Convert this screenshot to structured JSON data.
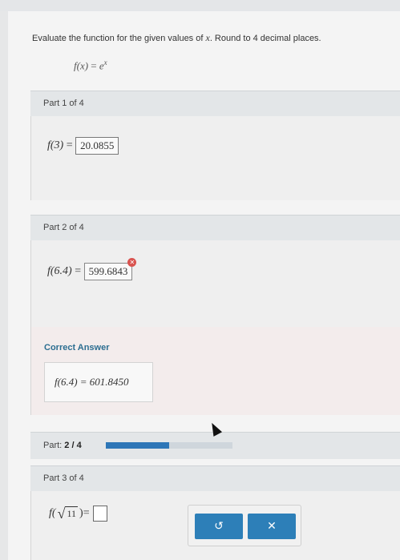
{
  "question": {
    "prefix": "Evaluate the function for the given values of ",
    "var": "x",
    "suffix": ". Round to 4 decimal places."
  },
  "function_def": {
    "lhs": "f(x)",
    "eq": " = ",
    "base": "e",
    "exponent": "x"
  },
  "parts": [
    {
      "label": "Part 1 of 4",
      "lhs": "f(3)",
      "eq": " = ",
      "answer": "20.0855"
    },
    {
      "label": "Part 2 of 4",
      "lhs": "f(6.4)",
      "eq": " = ",
      "answer": "599.6843"
    },
    {
      "label": "Part 3 of 4",
      "lhs_open": "f(",
      "radicand": "11",
      "lhs_close": ")",
      "eq": " = "
    }
  ],
  "correct_answer": {
    "title": "Correct Answer",
    "text": "f(6.4) = 601.8450"
  },
  "progress": {
    "label": "Part:",
    "value": "2 / 4",
    "fraction": 0.5
  },
  "buttons": {
    "undo_icon": "undo-icon",
    "undo_glyph": "↺",
    "clear_icon": "close-icon",
    "clear_glyph": "✕"
  },
  "colors": {
    "accent": "#2d7fb8",
    "progress": "#2d76b7",
    "error": "#d9534f",
    "correct_title": "#2c6e91"
  }
}
